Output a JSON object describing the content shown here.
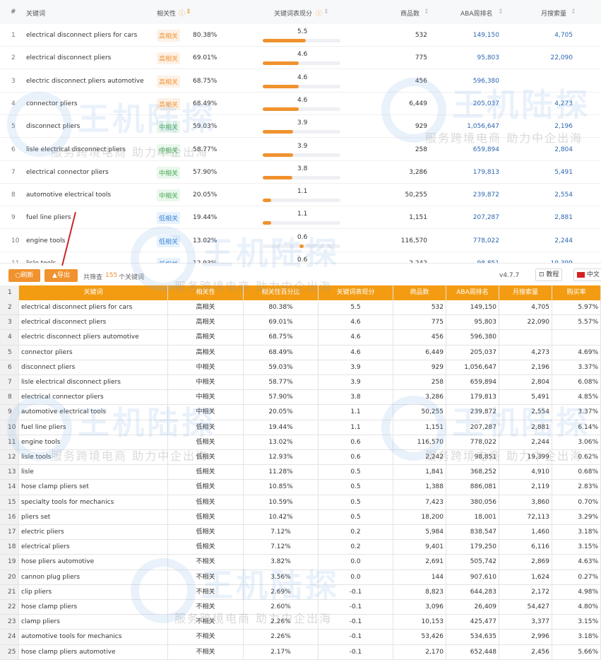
{
  "top_table": {
    "headers": {
      "index": "#",
      "keyword": "关键词",
      "relevance": "相关性",
      "score": "关键词表现分",
      "products": "商品数",
      "aba_rank": "ABA周排名",
      "monthly": "月搜索量"
    },
    "rows": [
      {
        "n": "1",
        "kw": "electrical disconnect pliers for cars",
        "badge": "高相关",
        "level": "h",
        "pct": "80.38%",
        "score": "5.5",
        "score_value": 5.5,
        "products": "532",
        "aba": "149,150",
        "monthly": "4,705"
      },
      {
        "n": "2",
        "kw": "electrical disconnect pliers",
        "badge": "高相关",
        "level": "h",
        "pct": "69.01%",
        "score": "4.6",
        "score_value": 4.6,
        "products": "775",
        "aba": "95,803",
        "monthly": "22,090"
      },
      {
        "n": "3",
        "kw": "electric disconnect pliers automotive",
        "badge": "高相关",
        "level": "h",
        "pct": "68.75%",
        "score": "4.6",
        "score_value": 4.6,
        "products": "456",
        "aba": "596,380",
        "monthly": ""
      },
      {
        "n": "4",
        "kw": "connector pliers",
        "badge": "高相关",
        "level": "h",
        "pct": "68.49%",
        "score": "4.6",
        "score_value": 4.6,
        "products": "6,449",
        "aba": "205,037",
        "monthly": "4,273"
      },
      {
        "n": "5",
        "kw": "disconnect pliers",
        "badge": "中相关",
        "level": "m",
        "pct": "59.03%",
        "score": "3.9",
        "score_value": 3.9,
        "products": "929",
        "aba": "1,056,647",
        "monthly": "2,196"
      },
      {
        "n": "6",
        "kw": "lisle electrical disconnect pliers",
        "badge": "中相关",
        "level": "m",
        "pct": "58.77%",
        "score": "3.9",
        "score_value": 3.9,
        "products": "258",
        "aba": "659,894",
        "monthly": "2,804"
      },
      {
        "n": "7",
        "kw": "electrical connector pliers",
        "badge": "中相关",
        "level": "m",
        "pct": "57.90%",
        "score": "3.8",
        "score_value": 3.8,
        "products": "3,286",
        "aba": "179,813",
        "monthly": "5,491"
      },
      {
        "n": "8",
        "kw": "automotive electrical tools",
        "badge": "中相关",
        "level": "m",
        "pct": "20.05%",
        "score": "1.1",
        "score_value": 1.1,
        "products": "50,255",
        "aba": "239,872",
        "monthly": "2,554"
      },
      {
        "n": "9",
        "kw": "fuel line pliers",
        "badge": "低相关",
        "level": "l",
        "pct": "19.44%",
        "score": "1.1",
        "score_value": 1.1,
        "products": "1,151",
        "aba": "207,287",
        "monthly": "2,881"
      },
      {
        "n": "10",
        "kw": "engine tools",
        "badge": "低相关",
        "level": "l",
        "pct": "13.02%",
        "score": "0.6",
        "score_value": 0.6,
        "products": "116,570",
        "aba": "778,022",
        "monthly": "2,244"
      },
      {
        "n": "11",
        "kw": "lisle tools",
        "badge": "低相关",
        "level": "l",
        "pct": "12.93%",
        "score": "0.6",
        "score_value": 0.6,
        "products": "2,242",
        "aba": "98,851",
        "monthly": "19,399"
      }
    ]
  },
  "toolbar": {
    "refresh": "○刷新",
    "export": "▲导出",
    "filter_prefix": "共筛查",
    "filter_count": "155",
    "filter_suffix": "个关键词",
    "version": "v4.7.7",
    "tutorial": "教程",
    "lang": "中文"
  },
  "sheet": {
    "headers": {
      "n": "1",
      "kw": "关键词",
      "rel": "相关性",
      "pct": "相关性百分比",
      "score": "关键词表现分",
      "products": "商品数",
      "aba": "ABA周排名",
      "monthly": "月搜索量",
      "buy": "购买率"
    },
    "rows": [
      {
        "n": "2",
        "kw": "electrical disconnect pliers for cars",
        "rel": "高相关",
        "pct": "80.38%",
        "score": "5.5",
        "products": "532",
        "aba": "149,150",
        "monthly": "4,705",
        "buy": "5.97%"
      },
      {
        "n": "3",
        "kw": "electrical disconnect pliers",
        "rel": "高相关",
        "pct": "69.01%",
        "score": "4.6",
        "products": "775",
        "aba": "95,803",
        "monthly": "22,090",
        "buy": "5.57%"
      },
      {
        "n": "4",
        "kw": "electric disconnect pliers automotive",
        "rel": "高相关",
        "pct": "68.75%",
        "score": "4.6",
        "products": "456",
        "aba": "596,380",
        "monthly": "",
        "buy": ""
      },
      {
        "n": "5",
        "kw": "connector pliers",
        "rel": "高相关",
        "pct": "68.49%",
        "score": "4.6",
        "products": "6,449",
        "aba": "205,037",
        "monthly": "4,273",
        "buy": "4.69%"
      },
      {
        "n": "6",
        "kw": "disconnect pliers",
        "rel": "中相关",
        "pct": "59.03%",
        "score": "3.9",
        "products": "929",
        "aba": "1,056,647",
        "monthly": "2,196",
        "buy": "3.37%"
      },
      {
        "n": "7",
        "kw": "lisle electrical disconnect pliers",
        "rel": "中相关",
        "pct": "58.77%",
        "score": "3.9",
        "products": "258",
        "aba": "659,894",
        "monthly": "2,804",
        "buy": "6.08%"
      },
      {
        "n": "8",
        "kw": "electrical connector pliers",
        "rel": "中相关",
        "pct": "57.90%",
        "score": "3.8",
        "products": "3,286",
        "aba": "179,813",
        "monthly": "5,491",
        "buy": "4.85%"
      },
      {
        "n": "9",
        "kw": "automotive electrical tools",
        "rel": "中相关",
        "pct": "20.05%",
        "score": "1.1",
        "products": "50,255",
        "aba": "239,872",
        "monthly": "2,554",
        "buy": "3.37%"
      },
      {
        "n": "10",
        "kw": "fuel line pliers",
        "rel": "低相关",
        "pct": "19.44%",
        "score": "1.1",
        "products": "1,151",
        "aba": "207,287",
        "monthly": "2,881",
        "buy": "6.14%"
      },
      {
        "n": "11",
        "kw": "engine tools",
        "rel": "低相关",
        "pct": "13.02%",
        "score": "0.6",
        "products": "116,570",
        "aba": "778,022",
        "monthly": "2,244",
        "buy": "3.06%"
      },
      {
        "n": "12",
        "kw": "lisle tools",
        "rel": "低相关",
        "pct": "12.93%",
        "score": "0.6",
        "products": "2,242",
        "aba": "98,851",
        "monthly": "19,399",
        "buy": "0.62%"
      },
      {
        "n": "13",
        "kw": "lisle",
        "rel": "低相关",
        "pct": "11.28%",
        "score": "0.5",
        "products": "1,841",
        "aba": "368,252",
        "monthly": "4,910",
        "buy": "0.68%"
      },
      {
        "n": "14",
        "kw": "hose clamp pliers set",
        "rel": "低相关",
        "pct": "10.85%",
        "score": "0.5",
        "products": "1,388",
        "aba": "886,081",
        "monthly": "2,119",
        "buy": "2.83%"
      },
      {
        "n": "15",
        "kw": "specialty tools for mechanics",
        "rel": "低相关",
        "pct": "10.59%",
        "score": "0.5",
        "products": "7,423",
        "aba": "380,056",
        "monthly": "3,860",
        "buy": "0.70%"
      },
      {
        "n": "16",
        "kw": "pliers set",
        "rel": "低相关",
        "pct": "10.42%",
        "score": "0.5",
        "products": "18,200",
        "aba": "18,001",
        "monthly": "72,113",
        "buy": "3.29%"
      },
      {
        "n": "17",
        "kw": "electric pliers",
        "rel": "低相关",
        "pct": "7.12%",
        "score": "0.2",
        "products": "5,984",
        "aba": "838,547",
        "monthly": "1,460",
        "buy": "3.18%"
      },
      {
        "n": "18",
        "kw": "electrical pliers",
        "rel": "低相关",
        "pct": "7.12%",
        "score": "0.2",
        "products": "9,401",
        "aba": "179,250",
        "monthly": "6,116",
        "buy": "3.15%"
      },
      {
        "n": "19",
        "kw": "hose pliers automotive",
        "rel": "不相关",
        "pct": "3.82%",
        "score": "0.0",
        "products": "2,691",
        "aba": "505,742",
        "monthly": "2,869",
        "buy": "4.63%"
      },
      {
        "n": "20",
        "kw": "cannon plug pliers",
        "rel": "不相关",
        "pct": "3.56%",
        "score": "0.0",
        "products": "144",
        "aba": "907,610",
        "monthly": "1,624",
        "buy": "0.27%"
      },
      {
        "n": "21",
        "kw": "clip pliers",
        "rel": "不相关",
        "pct": "2.69%",
        "score": "-0.1",
        "products": "8,823",
        "aba": "644,283",
        "monthly": "2,172",
        "buy": "4.98%"
      },
      {
        "n": "22",
        "kw": "hose clamp pliers",
        "rel": "不相关",
        "pct": "2.60%",
        "score": "-0.1",
        "products": "3,096",
        "aba": "26,409",
        "monthly": "54,427",
        "buy": "4.80%"
      },
      {
        "n": "23",
        "kw": "clamp pliers",
        "rel": "不相关",
        "pct": "2.26%",
        "score": "-0.1",
        "products": "10,153",
        "aba": "425,477",
        "monthly": "3,377",
        "buy": "3.15%"
      },
      {
        "n": "24",
        "kw": "automotive tools for mechanics",
        "rel": "不相关",
        "pct": "2.26%",
        "score": "-0.1",
        "products": "53,426",
        "aba": "534,635",
        "monthly": "2,996",
        "buy": "3.18%"
      },
      {
        "n": "25",
        "kw": "hose clamp pliers automotive",
        "rel": "不相关",
        "pct": "2.17%",
        "score": "-0.1",
        "products": "2,170",
        "aba": "652,448",
        "monthly": "2,456",
        "buy": "5.66%"
      }
    ]
  },
  "watermark": {
    "brand": "王机陆探",
    "slogan": "服务跨境电商 助力中企出海"
  },
  "colors": {
    "accent": "#f0922e",
    "high": "#f09433",
    "mid": "#45a955",
    "low": "#3a86d8",
    "link": "#2b66b0"
  },
  "score_max": 10
}
